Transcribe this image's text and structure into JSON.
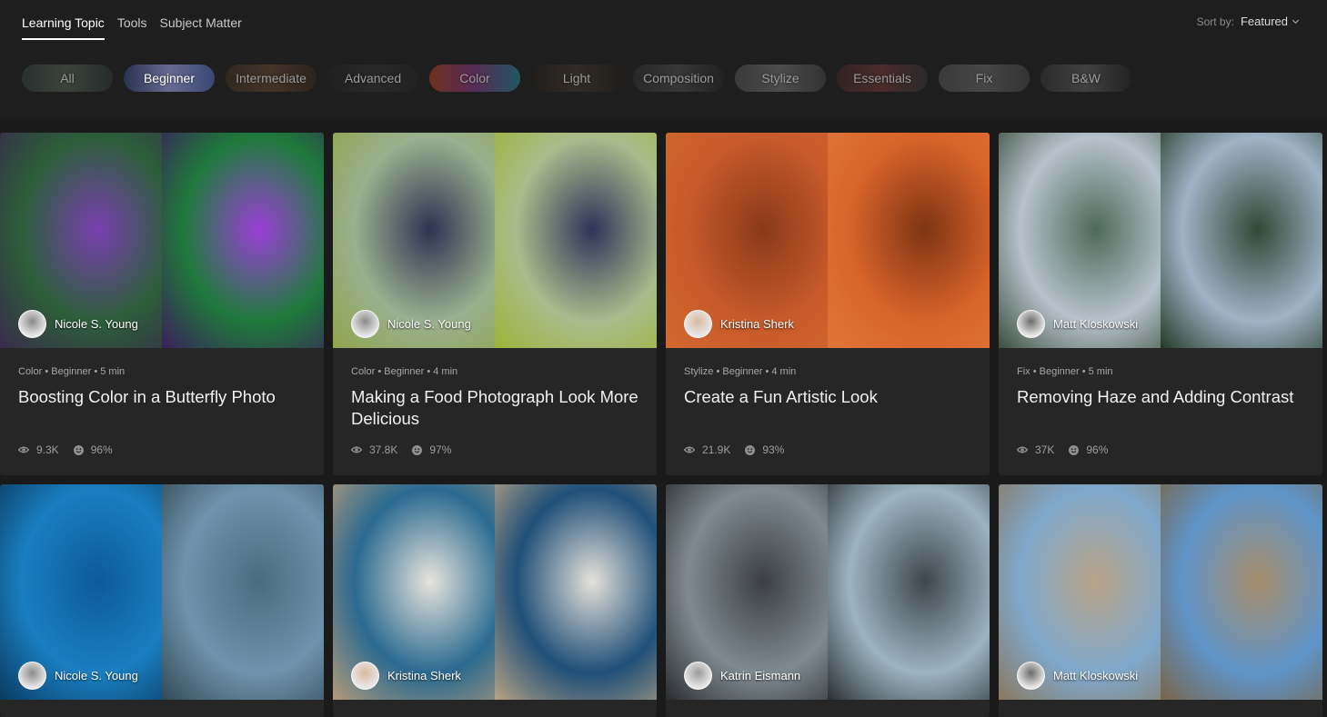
{
  "header": {
    "tabs": [
      {
        "label": "Learning Topic",
        "active": true
      },
      {
        "label": "Tools",
        "active": false
      },
      {
        "label": "Subject Matter",
        "active": false
      }
    ],
    "sort_label": "Sort by:",
    "sort_value": "Featured"
  },
  "filters": [
    {
      "label": "All",
      "active": false,
      "colors": [
        "#3a4a4a",
        "#5c6a5a",
        "#33403f"
      ]
    },
    {
      "label": "Beginner",
      "active": true,
      "colors": [
        "#2b3554",
        "#6d6f9a",
        "#3b4a78"
      ]
    },
    {
      "label": "Intermediate",
      "active": false,
      "colors": [
        "#4a3a2c",
        "#6b4f3a",
        "#3e3024"
      ]
    },
    {
      "label": "Advanced",
      "active": false,
      "colors": [
        "#2a2a2a",
        "#3b3b3b",
        "#2d2d2d"
      ]
    },
    {
      "label": "Color",
      "active": false,
      "colors": [
        "#b5482c",
        "#8f3f8c",
        "#2b8fa0"
      ]
    },
    {
      "label": "Light",
      "active": false,
      "colors": [
        "#2a2521",
        "#4b4036",
        "#2a2521"
      ]
    },
    {
      "label": "Composition",
      "active": false,
      "colors": [
        "#3a3a3a",
        "#555555",
        "#2e2e2e"
      ]
    },
    {
      "label": "Stylize",
      "active": false,
      "colors": [
        "#5a5a5a",
        "#7a7a7a",
        "#4c4c4c"
      ]
    },
    {
      "label": "Essentials",
      "active": false,
      "colors": [
        "#4a3030",
        "#7a4040",
        "#3c3c3c"
      ]
    },
    {
      "label": "Fix",
      "active": false,
      "colors": [
        "#5a5a5a",
        "#707070",
        "#4e4e4e"
      ]
    },
    {
      "label": "B&W",
      "active": false,
      "colors": [
        "#3e3e3e",
        "#666666",
        "#2e2e2e"
      ]
    }
  ],
  "cards": [
    {
      "author": "Nicole S. Young",
      "meta": "Color • Beginner • 5 min",
      "title": "Boosting Color in a Butterfly Photo",
      "views": "9.3K",
      "rating": "96%",
      "colors": {
        "left": [
          "#2c5e3a",
          "#7a3fb0",
          "#3a2a4a"
        ],
        "right": [
          "#1f7a3c",
          "#9b3fd8",
          "#3a1f5a"
        ],
        "avatar": "#8a8a8a"
      }
    },
    {
      "author": "Nicole S. Young",
      "meta": "Color • Beginner • 4 min",
      "title": "Making a Food Photograph Look More Delicious",
      "views": "37.8K",
      "rating": "97%",
      "colors": {
        "left": [
          "#9ab08f",
          "#2e3352",
          "#8fa44a"
        ],
        "right": [
          "#a9bb8c",
          "#2d345a",
          "#9cb438"
        ],
        "avatar": "#8a8a8a"
      }
    },
    {
      "author": "Kristina Sherk",
      "meta": "Stylize • Beginner • 4 min",
      "title": "Create a Fun Artistic Look",
      "views": "21.9K",
      "rating": "93%",
      "colors": {
        "left": [
          "#c65a2a",
          "#8a3a1a",
          "#d2692f"
        ],
        "right": [
          "#d8642a",
          "#7e3414",
          "#e0763a"
        ],
        "avatar": "#d9b8a0"
      }
    },
    {
      "author": "Matt Kloskowski",
      "meta": "Fix • Beginner • 5 min",
      "title": "Removing Haze and Adding Contrast",
      "views": "37K",
      "rating": "96%",
      "colors": {
        "left": [
          "#b7c2cc",
          "#4d6a58",
          "#3b4f3c"
        ],
        "right": [
          "#9fb3c6",
          "#2f4a36",
          "#263a28"
        ],
        "avatar": "#6a6a6a"
      }
    },
    {
      "author": "Nicole S. Young",
      "meta": "",
      "title": "",
      "views": "",
      "rating": "",
      "colors": {
        "left": [
          "#1a7ec0",
          "#0d5a9a",
          "#0a3a60"
        ],
        "right": [
          "#6f93ad",
          "#4a6c80",
          "#324a55"
        ],
        "avatar": "#8a8a8a"
      }
    },
    {
      "author": "Kristina Sherk",
      "meta": "",
      "title": "",
      "views": "",
      "rating": "",
      "colors": {
        "left": [
          "#2a6a90",
          "#e8e4dc",
          "#b49a7a"
        ],
        "right": [
          "#1f4f78",
          "#e6e2da",
          "#b8a284"
        ],
        "avatar": "#d9b8a0"
      }
    },
    {
      "author": "Katrin Eismann",
      "meta": "",
      "title": "",
      "views": "",
      "rating": "",
      "colors": {
        "left": [
          "#7f8a90",
          "#3c3f44",
          "#2a2c2f"
        ],
        "right": [
          "#9bb4c0",
          "#3f464c",
          "#2c3034"
        ],
        "avatar": "#9a9a9a"
      }
    },
    {
      "author": "Matt Kloskowski",
      "meta": "",
      "title": "",
      "views": "",
      "rating": "",
      "colors": {
        "left": [
          "#7fa8cc",
          "#b9a488",
          "#8a7860"
        ],
        "right": [
          "#5f94c8",
          "#a88e6c",
          "#7a6448"
        ],
        "avatar": "#6a6a6a"
      }
    }
  ]
}
